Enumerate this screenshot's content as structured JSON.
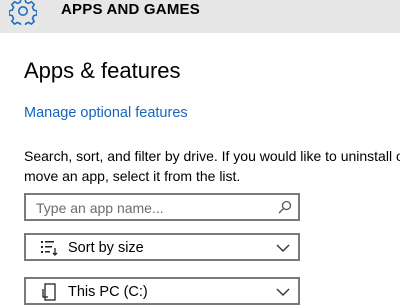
{
  "header": {
    "title": "APPS AND GAMES",
    "icon": "gear-icon"
  },
  "main": {
    "title": "Apps & features",
    "link_label": "Manage optional features",
    "description_line1": "Search, sort, and filter by drive. If you would like to uninstall or",
    "description_line2": "move an app, select it from the list.",
    "search": {
      "placeholder": "Type an app name...",
      "icon": "search-icon"
    },
    "sort": {
      "value": "Sort by size",
      "icon": "sort-icon"
    },
    "drive": {
      "value": "This PC (C:)",
      "icon": "pc-icon"
    }
  },
  "colors": {
    "link": "#1565c0",
    "header_bg": "#e6e6e6",
    "gear": "#1f6fbf",
    "border": "#7a7a7a"
  }
}
